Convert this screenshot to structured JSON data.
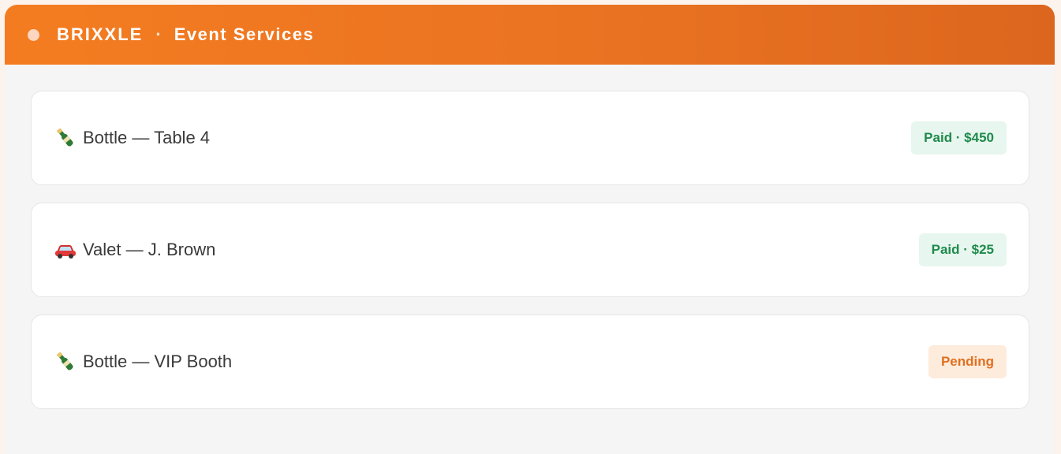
{
  "header": {
    "brand": "BRIXXLE",
    "separator": "·",
    "subtitle": "Event Services"
  },
  "services": [
    {
      "icon": "champagne-bottle-icon",
      "label": "Bottle — Table 4",
      "status": "Paid · $450",
      "status_type": "paid"
    },
    {
      "icon": "car-icon",
      "label": "Valet — J. Brown",
      "status": "Paid · $25",
      "status_type": "paid"
    },
    {
      "icon": "champagne-bottle-icon",
      "label": "Bottle — VIP Booth",
      "status": "Pending",
      "status_type": "pending"
    }
  ],
  "colors": {
    "header_start": "#f47c20",
    "header_end": "#dc661d",
    "paid_bg": "#e7f6ee",
    "paid_text": "#1f8a4c",
    "pending_bg": "#fdebdc",
    "pending_text": "#e0701f"
  }
}
